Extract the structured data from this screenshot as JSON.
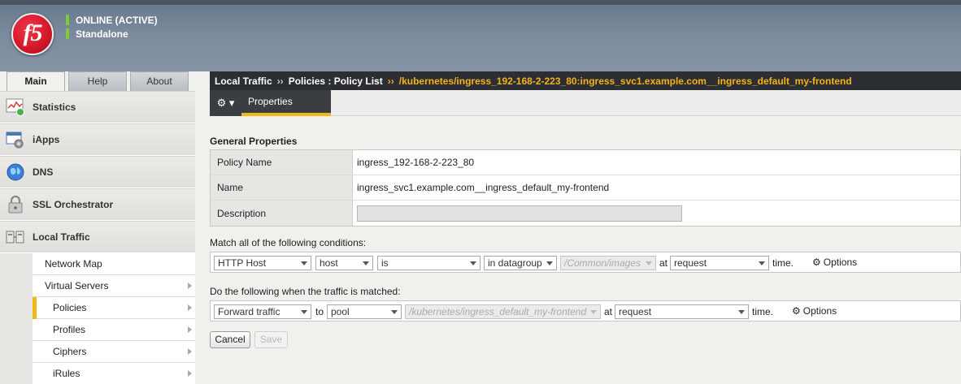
{
  "header": {
    "logo_text": "f5",
    "status_lines": [
      "ONLINE (ACTIVE)",
      "Standalone"
    ]
  },
  "tabs": [
    "Main",
    "Help",
    "About"
  ],
  "sidebar": {
    "items": [
      {
        "label": "Statistics",
        "icon": "statistics-icon"
      },
      {
        "label": "iApps",
        "icon": "iapps-icon"
      },
      {
        "label": "DNS",
        "icon": "dns-globe-icon"
      },
      {
        "label": "SSL Orchestrator",
        "icon": "ssl-lock-icon"
      },
      {
        "label": "Local Traffic",
        "icon": "local-traffic-icon"
      }
    ],
    "sub_items": [
      "Network Map",
      "Virtual Servers",
      "Policies",
      "Profiles",
      "Ciphers",
      "iRules"
    ],
    "active_sub_item": "Policies"
  },
  "breadcrumb": {
    "part1": "Local Traffic",
    "sep1": "››",
    "part2": "Policies : Policy List",
    "sep2": "››",
    "current": "/kubernetes/ingress_192-168-2-223_80:ingress_svc1.example.com__ingress_default_my-frontend"
  },
  "toolbar": {
    "gear_label": "⚙ ▾",
    "properties_tab": "Properties"
  },
  "general": {
    "title": "General Properties",
    "rows": [
      {
        "label": "Policy Name",
        "value": "ingress_192-168-2-223_80"
      },
      {
        "label": "Name",
        "value": "ingress_svc1.example.com__ingress_default_my-frontend"
      },
      {
        "label": "Description",
        "value": ""
      }
    ]
  },
  "conditions": {
    "heading": "Match all of the following conditions:",
    "operand": "HTTP Host",
    "selector": "host",
    "operator": "is",
    "match_type": "in datagroup",
    "datagroup": "/Common/images",
    "at_text": "at",
    "event": "request",
    "time_text": "time.",
    "options_label": "Options"
  },
  "actions": {
    "heading": "Do the following when the traffic is matched:",
    "action": "Forward traffic",
    "to_text": "to",
    "target": "pool",
    "pool": "/kubernetes/ingress_default_my-frontend",
    "at_text": "at",
    "event": "request",
    "time_text": "time.",
    "options_label": "Options"
  },
  "buttons": {
    "cancel": "Cancel",
    "save": "Save"
  },
  "colors": {
    "accent": "#f2b818",
    "breadcrumb_current": "#f5b21a",
    "status_green": "#7ecb3a",
    "logo_red": "#d4192b"
  }
}
